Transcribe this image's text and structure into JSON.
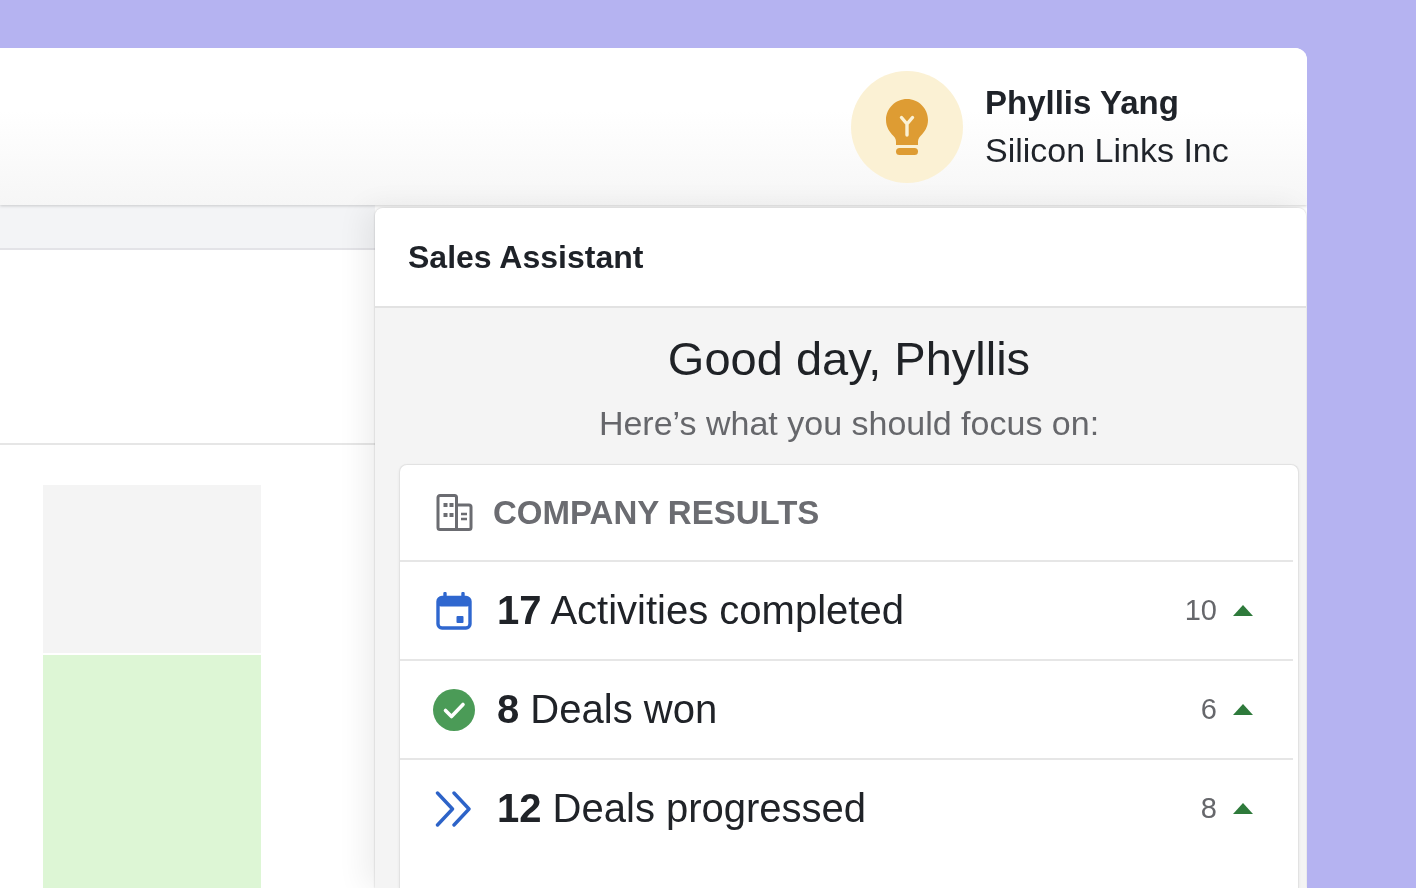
{
  "header": {
    "user": {
      "name": "Phyllis Yang",
      "company": "Silicon Links Inc"
    }
  },
  "sales_assistant": {
    "title": "Sales Assistant",
    "greeting": "Good day, Phyllis",
    "prompt": "Here’s what you should focus on:",
    "company_results": {
      "title": "COMPANY RESULTS",
      "rows": [
        {
          "kind": "calendar",
          "text": "**17** Activities completed",
          "comparison": "10",
          "trend_up": true
        },
        {
          "kind": "check",
          "text": "**8** Deals won",
          "comparison": "6",
          "trend_up": true
        },
        {
          "kind": "chevrons",
          "text": "**12** Deals progressed",
          "comparison": "8",
          "trend_up": true
        }
      ]
    }
  }
}
